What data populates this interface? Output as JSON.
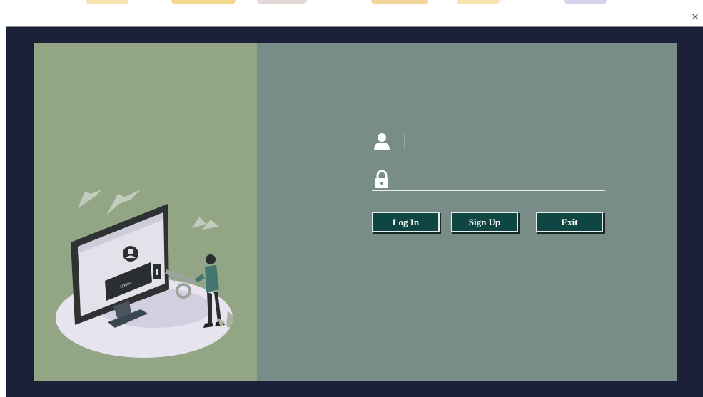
{
  "window": {
    "close_symbol": "×"
  },
  "login_form": {
    "username": {
      "icon": "user-icon",
      "value": "",
      "placeholder": ""
    },
    "password": {
      "icon": "lock-icon",
      "value": "",
      "placeholder": ""
    },
    "buttons": {
      "login": "Log In",
      "signup": "Sign Up",
      "exit": "Exit"
    }
  },
  "illustration": {
    "screen_caption": "LOGIN",
    "description_icon": "login-security-illustration"
  },
  "colors": {
    "window_frame": "#1c2137",
    "left_panel": "#92a584",
    "right_panel": "#788d87",
    "button_bg": "#0f4643",
    "field_line": "#e7ecea"
  }
}
